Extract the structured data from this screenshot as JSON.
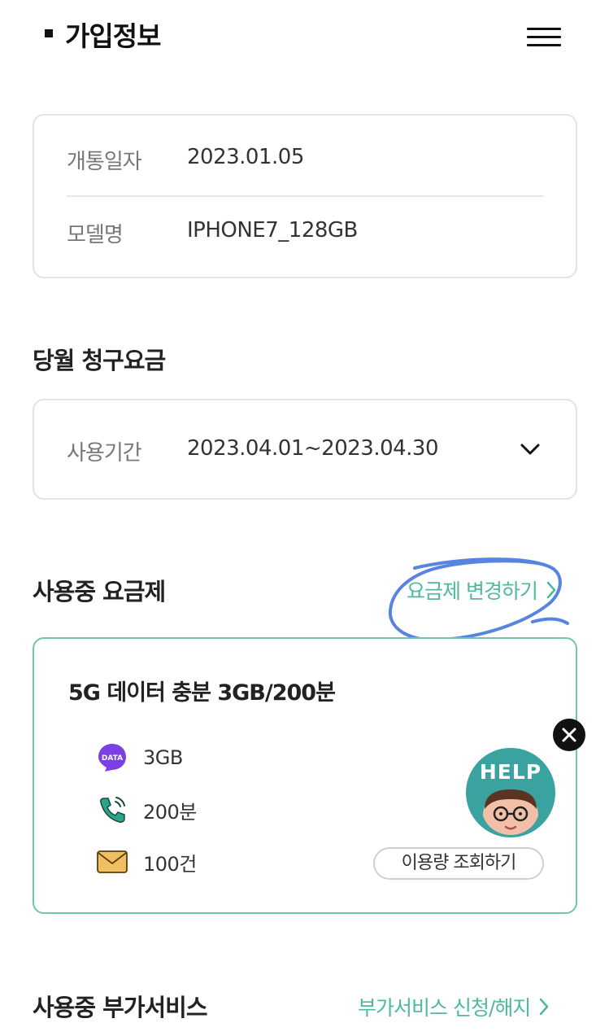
{
  "header": {
    "title": "가입정보",
    "menu_icon": "hamburger-menu-icon"
  },
  "subscription": {
    "rows": [
      {
        "label": "개통일자",
        "value": "2023.01.05"
      },
      {
        "label": "모델명",
        "value": "IPHONE7_128GB"
      }
    ]
  },
  "billing": {
    "title": "당월 청구요금",
    "period_label": "사용기간",
    "period_value": "2023.04.01~2023.04.30"
  },
  "plan": {
    "title": "사용중 요금제",
    "change_link": "요금제 변경하기",
    "name": "5G 데이터 충분 3GB/200분",
    "data_badge": "DATA",
    "items": [
      {
        "icon": "data-icon",
        "value": "3GB"
      },
      {
        "icon": "phone-icon",
        "value": "200분"
      },
      {
        "icon": "envelope-icon",
        "value": "100건"
      }
    ],
    "usage_button": "이용량 조회하기"
  },
  "addons": {
    "title": "사용중 부가서비스",
    "link": "부가서비스 신청/해지"
  },
  "help": {
    "label": "HELP"
  },
  "colors": {
    "accent": "#4fb8a0",
    "plan_border": "#6ec6b2",
    "data_icon": "#7b3fe4",
    "envelope": "#f0c060",
    "scribble": "#3a6fd8"
  }
}
